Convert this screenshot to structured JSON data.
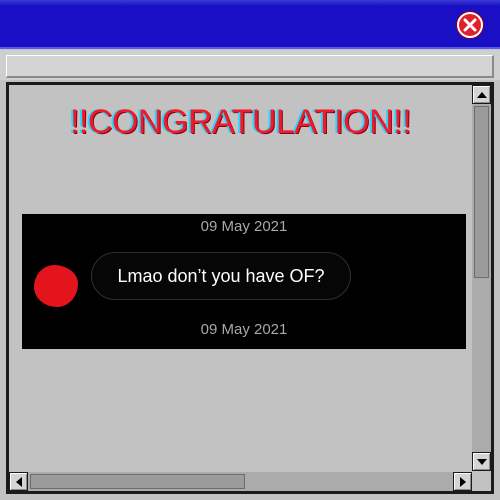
{
  "window": {
    "close_icon": "close-icon"
  },
  "content": {
    "headline": "!!CONGRATULATION!!"
  },
  "chat": {
    "date_top": "09 May 2021",
    "message": "Lmao don’t you have OF?",
    "date_bottom": "09 May 2021"
  },
  "colors": {
    "titlebar": "#1a0fc4",
    "headline": "#ee1c2a",
    "avatar": "#e4141d",
    "close_button": "#e0202a"
  }
}
